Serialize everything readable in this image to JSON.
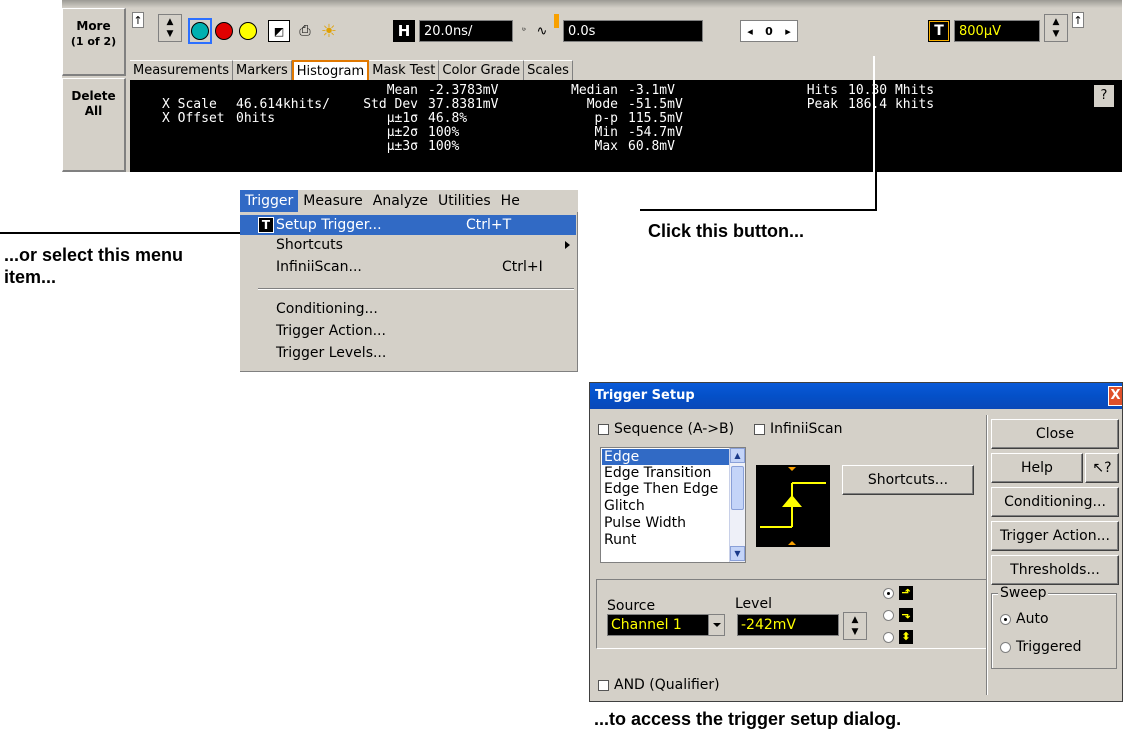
{
  "side_buttons": {
    "more_line1": "More",
    "more_line2": "(1 of 2)",
    "delete_line1": "Delete",
    "delete_line2": "All"
  },
  "toolbar": {
    "h_label": "H",
    "timebase": "20.0ns/",
    "delay": "0.0s",
    "nav_left": "◂",
    "nav_value": "0",
    "nav_right": "▸",
    "t_label": "T",
    "trigger_level": "800µV",
    "icons": [
      "pointer-arrow-icon",
      "up-down-spinner-icon",
      "cyan-circle-icon",
      "red-circle-icon",
      "yellow-circle-icon",
      "waveform-window-icon",
      "print-icon",
      "brightness-icon",
      "pulse-icon",
      "sine-icon",
      "marker-icon"
    ]
  },
  "tabs": [
    "Measurements",
    "Markers",
    "Histogram",
    "Mask Test",
    "Color Grade",
    "Scales"
  ],
  "active_tab": "Histogram",
  "histogram": {
    "x_scale_label": "X Scale",
    "x_scale_value": "46.614khits/",
    "x_offset_label": "X Offset",
    "x_offset_value": "0hits",
    "mean_label": "Mean",
    "mean_value": "-2.3783mV",
    "std_dev_label": "Std Dev",
    "std_dev_value": "37.8381mV",
    "sigma1_label": "µ±1σ",
    "sigma1_value": "46.8%",
    "sigma2_label": "µ±2σ",
    "sigma2_value": "100%",
    "sigma3_label": "µ±3σ",
    "sigma3_value": "100%",
    "median_label": "Median",
    "median_value": "-3.1mV",
    "mode_label": "Mode",
    "mode_value": "-51.5mV",
    "pp_label": "p-p",
    "pp_value": "115.5mV",
    "min_label": "Min",
    "min_value": "-54.7mV",
    "max_label": "Max",
    "max_value": "60.8mV",
    "hits_label": "Hits",
    "hits_value": "10.30 Mhits",
    "peak_label": "Peak",
    "peak_value": "186.4 khits",
    "help": "?"
  },
  "callouts": {
    "menu_item": "...or select this menu item...",
    "button": "Click this button...",
    "dialog": "...to access the trigger setup dialog."
  },
  "menubar": [
    "Trigger",
    "Measure",
    "Analyze",
    "Utilities",
    "He"
  ],
  "menu": {
    "items": [
      {
        "label": "Setup Trigger...",
        "shortcut": "Ctrl+T"
      },
      {
        "label": "Shortcuts",
        "shortcut": ""
      },
      {
        "label": "InfiniiScan...",
        "shortcut": "Ctrl+I"
      },
      {
        "label": "Conditioning...",
        "shortcut": ""
      },
      {
        "label": "Trigger Action...",
        "shortcut": ""
      },
      {
        "label": "Trigger Levels...",
        "shortcut": ""
      }
    ],
    "t_icon": "T"
  },
  "dialog": {
    "title": "Trigger Setup",
    "close_x": "X",
    "sequence_label": "Sequence (A->B)",
    "infiniiscan_label": "InfiniiScan",
    "modes": [
      "Edge",
      "Edge Transition",
      "Edge Then Edge",
      "Glitch",
      "Pulse Width",
      "Runt"
    ],
    "selected_mode": "Edge",
    "shortcuts_button": "Shortcuts...",
    "source_label": "Source",
    "source_value": "Channel 1",
    "level_label": "Level",
    "level_value": "-242mV",
    "and_label": "AND (Qualifier)",
    "close_button": "Close",
    "help_button": "Help",
    "whats_this": "↖?",
    "conditioning_button": "Conditioning...",
    "trigger_action_button": "Trigger Action...",
    "thresholds_button": "Thresholds...",
    "sweep_label": "Sweep",
    "sweep_auto": "Auto",
    "sweep_triggered": "Triggered",
    "slope_rising": "⬏",
    "slope_falling": "⬎",
    "slope_either": "⬍"
  }
}
